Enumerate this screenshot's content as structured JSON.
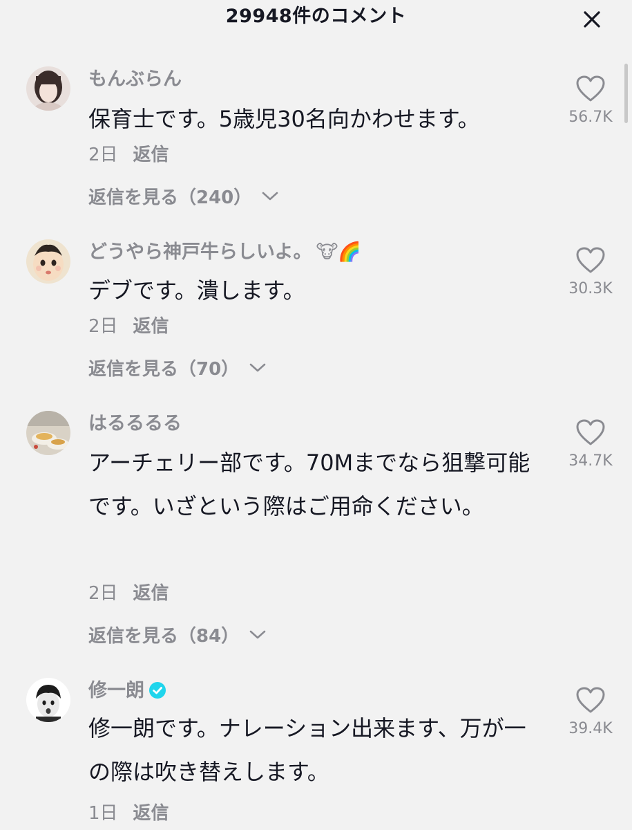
{
  "header": {
    "title": "29948件のコメント"
  },
  "comments": [
    {
      "username": "もんぶらん",
      "username_extra": "",
      "verified": false,
      "text": "保育士です。5歳児30名向かわせます。",
      "date": "2日",
      "reply_label": "返信",
      "view_replies": "返信を見る（240）",
      "likes": "56.7K"
    },
    {
      "username": "どうやら神戸牛らしいよ。",
      "username_extra": "🐮🌈",
      "verified": false,
      "text": "デブです。潰します。",
      "date": "2日",
      "reply_label": "返信",
      "view_replies": "返信を見る（70）",
      "likes": "30.3K"
    },
    {
      "username": "はるるるる",
      "username_extra": "",
      "verified": false,
      "text": "アーチェリー部です。70Mまでなら狙撃可能です。いざという際はご用命ください。",
      "date": "2日",
      "reply_label": "返信",
      "view_replies": "返信を見る（84）",
      "likes": "34.7K"
    },
    {
      "username": "修一朗",
      "username_extra": "",
      "verified": true,
      "text": "修一朗です。ナレーション出来ます、万が一の際は吹き替えします。",
      "date": "1日",
      "reply_label": "返信",
      "view_replies": "",
      "likes": "39.4K"
    }
  ]
}
